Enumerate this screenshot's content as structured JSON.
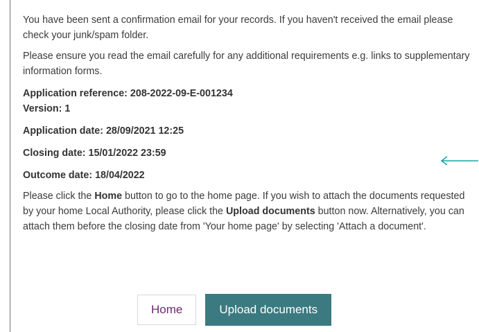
{
  "message": {
    "confirmation": "You have been sent a confirmation email for your records. If you haven't received the email please check your junk/spam folder.",
    "ensure": "Please ensure you read the email carefully for any additional requirements e.g. links to supplementary information forms."
  },
  "details": {
    "reference": "Application reference: 208-2022-09-E-001234",
    "version": "Version: 1",
    "application_date": "Application date: 28/09/2021 12:25",
    "closing_date": "Closing date: 15/01/2022 23:59",
    "outcome_date": "Outcome date: 18/04/2022"
  },
  "instructions": {
    "part1": "Please click the ",
    "home_bold": "Home",
    "part2": " button to go to the home page. If you wish to attach the documents requested by your home Local Authority, please click the ",
    "upload_bold": "Upload documents",
    "part3": " button now. Alternatively, you can attach them before the closing date from 'Your home page' by selecting 'Attach a document'."
  },
  "buttons": {
    "home_label": "Home",
    "upload_label": "Upload documents"
  },
  "colors": {
    "arrow": "#1aa3a6",
    "upload_bg": "#3b7a80",
    "home_text": "#6a2a6c"
  },
  "icons": {
    "annotation_arrow": "arrow-left-icon"
  }
}
